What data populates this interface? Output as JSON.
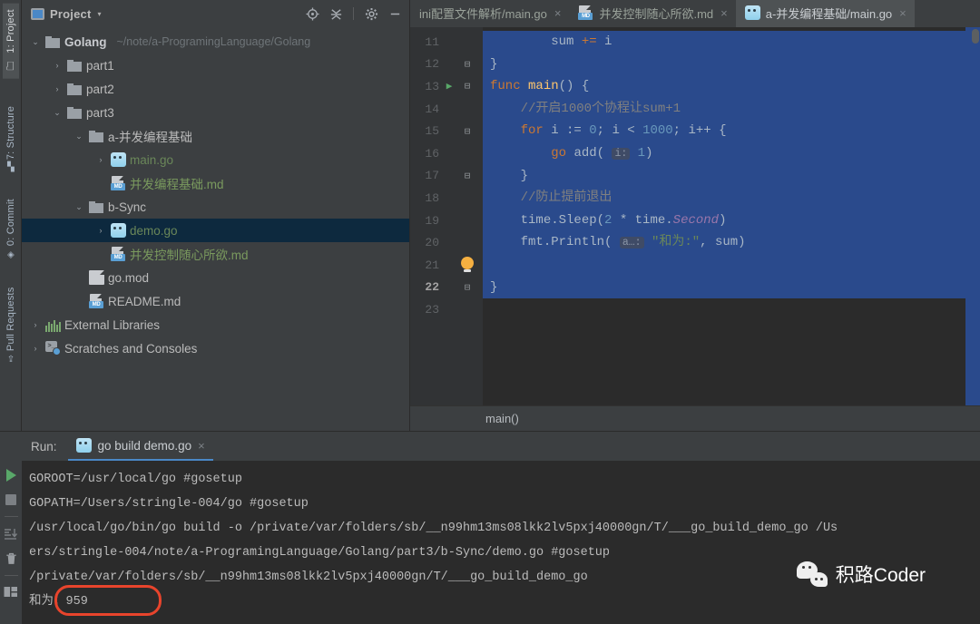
{
  "tool_strip": {
    "tabs": [
      {
        "label": "1: Project",
        "icon": "folder-icon",
        "active": true
      },
      {
        "label": "7: Structure",
        "icon": "structure-icon",
        "active": false
      },
      {
        "label": "0: Commit",
        "icon": "commit-icon",
        "active": false
      },
      {
        "label": "Pull Requests",
        "icon": "pull-request-icon",
        "active": false
      }
    ]
  },
  "project_panel": {
    "title": "Project",
    "caret": "▾",
    "actions": [
      {
        "name": "locate-icon",
        "glyph": "⊕"
      },
      {
        "name": "collapse-all-icon",
        "glyph": "⩧"
      },
      {
        "name": "settings-gear-icon",
        "glyph": "⚙"
      },
      {
        "name": "minimize-icon",
        "glyph": "—"
      }
    ],
    "tree": [
      {
        "indent": 0,
        "arrow": "⌄",
        "icon": "folder-icon",
        "label": "Golang",
        "path": "~/note/a-ProgramingLanguage/Golang",
        "style": "bold",
        "selected": false
      },
      {
        "indent": 1,
        "arrow": "›",
        "icon": "folder-icon",
        "label": "part1",
        "path": "",
        "style": "white",
        "selected": false
      },
      {
        "indent": 1,
        "arrow": "›",
        "icon": "folder-icon",
        "label": "part2",
        "path": "",
        "style": "white",
        "selected": false
      },
      {
        "indent": 1,
        "arrow": "⌄",
        "icon": "folder-icon",
        "label": "part3",
        "path": "",
        "style": "white",
        "selected": false
      },
      {
        "indent": 2,
        "arrow": "⌄",
        "icon": "folder-icon",
        "label": "a-并发编程基础",
        "path": "",
        "style": "white",
        "selected": false
      },
      {
        "indent": 3,
        "arrow": "›",
        "icon": "go-file-icon",
        "label": "main.go",
        "path": "",
        "style": "green",
        "selected": false
      },
      {
        "indent": 3,
        "arrow": "",
        "icon": "md-file-icon",
        "label": "并发编程基础.md",
        "path": "",
        "style": "mdgreen",
        "selected": false
      },
      {
        "indent": 2,
        "arrow": "⌄",
        "icon": "folder-icon",
        "label": "b-Sync",
        "path": "",
        "style": "white",
        "selected": false
      },
      {
        "indent": 3,
        "arrow": "›",
        "icon": "go-file-icon",
        "label": "demo.go",
        "path": "",
        "style": "green",
        "selected": true
      },
      {
        "indent": 3,
        "arrow": "",
        "icon": "md-file-icon",
        "label": "并发控制随心所欲.md",
        "path": "",
        "style": "mdgreen",
        "selected": false
      },
      {
        "indent": 2,
        "arrow": "",
        "icon": "doc-file-icon",
        "label": "go.mod",
        "path": "",
        "style": "white",
        "selected": false
      },
      {
        "indent": 2,
        "arrow": "",
        "icon": "md-file-icon",
        "label": "README.md",
        "path": "",
        "style": "white",
        "selected": false
      },
      {
        "indent": 0,
        "arrow": "›",
        "icon": "library-icon",
        "label": "External Libraries",
        "path": "",
        "style": "white",
        "selected": false
      },
      {
        "indent": 0,
        "arrow": "›",
        "icon": "scratch-icon",
        "label": "Scratches and Consoles",
        "path": "",
        "style": "white",
        "selected": false
      }
    ]
  },
  "editor": {
    "tabs": [
      {
        "label": "ini配置文件解析/main.go",
        "icon": "go-file-icon",
        "show_icon": false,
        "active": false,
        "close": "×"
      },
      {
        "label": "并发控制随心所欲.md",
        "icon": "md-file-icon",
        "show_icon": true,
        "active": false,
        "close": "×"
      },
      {
        "label": "a-并发编程基础/main.go",
        "icon": "go-file-icon",
        "show_icon": true,
        "active": true,
        "close": "×"
      }
    ],
    "breadcrumb": "main()",
    "lines": [
      {
        "num": "11",
        "fold": "",
        "run": false,
        "bulb": false,
        "selected": true,
        "indent": 2,
        "current": false,
        "tokens": [
          {
            "t": "pl",
            "v": "sum "
          },
          {
            "t": "kw",
            "v": "+= "
          },
          {
            "t": "pl",
            "v": "i"
          }
        ]
      },
      {
        "num": "12",
        "fold": "⊟",
        "run": false,
        "bulb": false,
        "selected": true,
        "indent": 0,
        "current": false,
        "tokens": [
          {
            "t": "pl",
            "v": "}"
          }
        ]
      },
      {
        "num": "13",
        "fold": "⊟",
        "run": true,
        "bulb": false,
        "selected": true,
        "indent": 0,
        "current": false,
        "tokens": [
          {
            "t": "kw",
            "v": "func "
          },
          {
            "t": "fn",
            "v": "main"
          },
          {
            "t": "pl",
            "v": "() {"
          }
        ]
      },
      {
        "num": "14",
        "fold": "",
        "run": false,
        "bulb": false,
        "selected": true,
        "indent": 1,
        "current": false,
        "tokens": [
          {
            "t": "cm",
            "v": "//开启1000个协程让sum+1"
          }
        ]
      },
      {
        "num": "15",
        "fold": "⊟",
        "run": false,
        "bulb": false,
        "selected": true,
        "indent": 1,
        "current": false,
        "tokens": [
          {
            "t": "kw",
            "v": "for "
          },
          {
            "t": "pl",
            "v": "i := "
          },
          {
            "t": "num",
            "v": "0"
          },
          {
            "t": "pl",
            "v": "; i < "
          },
          {
            "t": "num",
            "v": "1000"
          },
          {
            "t": "pl",
            "v": "; i++ {"
          }
        ]
      },
      {
        "num": "16",
        "fold": "",
        "run": false,
        "bulb": false,
        "selected": true,
        "indent": 2,
        "current": false,
        "tokens": [
          {
            "t": "kw",
            "v": "go "
          },
          {
            "t": "pl",
            "v": "add( "
          },
          {
            "t": "hint",
            "v": "i:"
          },
          {
            "t": "pl",
            "v": " "
          },
          {
            "t": "num",
            "v": "1"
          },
          {
            "t": "pl",
            "v": ")"
          }
        ]
      },
      {
        "num": "17",
        "fold": "⊟",
        "run": false,
        "bulb": false,
        "selected": true,
        "indent": 1,
        "current": false,
        "tokens": [
          {
            "t": "pl",
            "v": "}"
          }
        ]
      },
      {
        "num": "18",
        "fold": "",
        "run": false,
        "bulb": false,
        "selected": true,
        "indent": 1,
        "current": false,
        "tokens": [
          {
            "t": "cm",
            "v": "//防止提前退出"
          }
        ]
      },
      {
        "num": "19",
        "fold": "",
        "run": false,
        "bulb": false,
        "selected": true,
        "indent": 1,
        "current": false,
        "tokens": [
          {
            "t": "pl",
            "v": "time."
          },
          {
            "t": "pl",
            "v": "Sleep("
          },
          {
            "t": "num",
            "v": "2"
          },
          {
            "t": "pl",
            "v": " * time."
          },
          {
            "t": "ital",
            "v": "Second"
          },
          {
            "t": "pl",
            "v": ")"
          }
        ]
      },
      {
        "num": "20",
        "fold": "",
        "run": false,
        "bulb": false,
        "selected": true,
        "indent": 1,
        "current": false,
        "tokens": [
          {
            "t": "pl",
            "v": "fmt.Println( "
          },
          {
            "t": "hint",
            "v": "a…:"
          },
          {
            "t": "pl",
            "v": " "
          },
          {
            "t": "str",
            "v": "\"和为:\""
          },
          {
            "t": "pl",
            "v": ", sum)"
          }
        ]
      },
      {
        "num": "21",
        "fold": "",
        "run": false,
        "bulb": true,
        "selected": true,
        "indent": 0,
        "current": false,
        "tokens": []
      },
      {
        "num": "22",
        "fold": "⊟",
        "run": false,
        "bulb": false,
        "selected": true,
        "indent": 0,
        "current": true,
        "tokens": [
          {
            "t": "pl",
            "v": "}"
          }
        ]
      },
      {
        "num": "23",
        "fold": "",
        "run": false,
        "bulb": false,
        "selected": false,
        "indent": 0,
        "current": false,
        "tokens": []
      }
    ]
  },
  "run_panel": {
    "label": "Run:",
    "tab": {
      "label": "go build demo.go",
      "icon": "go-file-icon",
      "close": "×"
    },
    "tools": [
      {
        "name": "rerun-play-button",
        "kind": "play"
      },
      {
        "name": "stop-button",
        "kind": "stop"
      },
      {
        "name": "scroll-to-end-button",
        "kind": "scroll"
      },
      {
        "name": "clear-all-trash-button",
        "kind": "trash"
      },
      {
        "name": "layout-settings-button",
        "kind": "layout"
      }
    ],
    "output": [
      "GOROOT=/usr/local/go #gosetup",
      "GOPATH=/Users/stringle-004/go #gosetup",
      "/usr/local/go/bin/go build -o /private/var/folders/sb/__n99hm13ms08lkk2lv5pxj40000gn/T/___go_build_demo_go /Us",
      "ers/stringle-004/note/a-ProgramingLanguage/Golang/part3/b-Sync/demo.go #gosetup",
      "/private/var/folders/sb/__n99hm13ms08lkk2lv5pxj40000gn/T/___go_build_demo_go",
      "和为：959"
    ]
  },
  "watermark": {
    "text": "积路Coder"
  },
  "colors": {
    "panel_bg": "#3c3f41",
    "editor_bg": "#2b2b2b",
    "selection_blue": "#2a4a8c",
    "tree_selected": "#0d293e",
    "accent_blue": "#4a88c7",
    "annotation_red": "#e8442c",
    "green_text": "#6a8759",
    "keyword_orange": "#cc7832"
  }
}
